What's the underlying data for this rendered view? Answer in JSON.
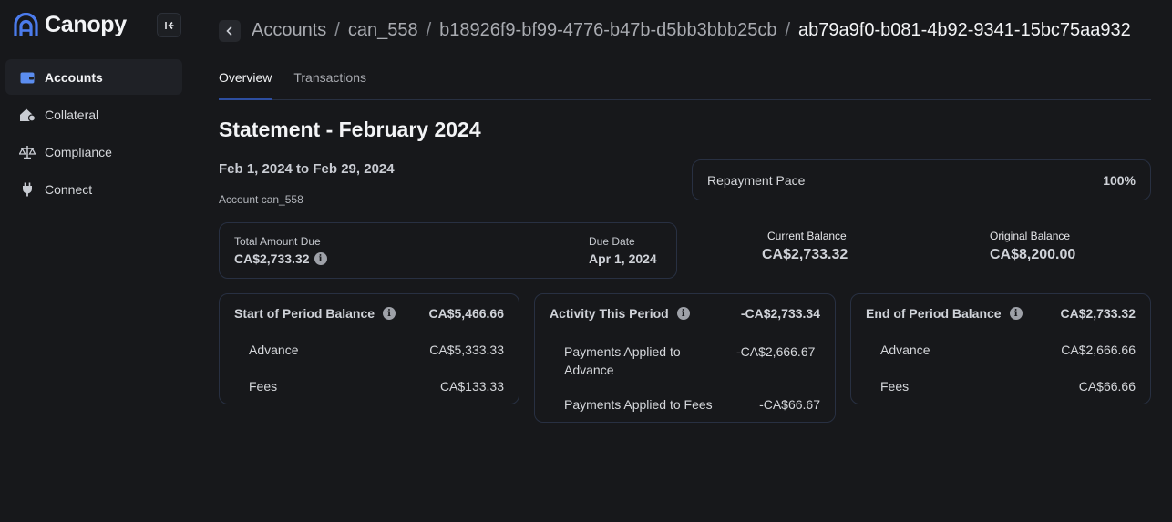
{
  "brand": {
    "name": "Canopy"
  },
  "sidebar": {
    "items": [
      {
        "label": "Accounts",
        "icon": "wallet-icon",
        "active": true
      },
      {
        "label": "Collateral",
        "icon": "house-icon",
        "active": false
      },
      {
        "label": "Compliance",
        "icon": "scale-icon",
        "active": false
      },
      {
        "label": "Connect",
        "icon": "plug-icon",
        "active": false
      }
    ]
  },
  "breadcrumb": {
    "items": [
      "Accounts",
      "can_558",
      "b18926f9-bf99-4776-b47b-d5bb3bbb25cb",
      "ab79a9f0-b081-4b92-9341-15bc75aa932"
    ],
    "separator": "/"
  },
  "tabs": [
    {
      "label": "Overview",
      "active": true
    },
    {
      "label": "Transactions",
      "active": false
    }
  ],
  "statement": {
    "title": "Statement - February 2024",
    "period": "Feb 1, 2024 to Feb 29, 2024",
    "account": "Account can_558",
    "repayment_pace_label": "Repayment Pace",
    "repayment_pace_value": "100%",
    "total_due_label": "Total Amount Due",
    "total_due_value": "CA$2,733.32",
    "due_date_label": "Due Date",
    "due_date_value": "Apr 1, 2024",
    "current_balance_label": "Current Balance",
    "current_balance_value": "CA$2,733.32",
    "original_balance_label": "Original Balance",
    "original_balance_value": "CA$8,200.00"
  },
  "cards": {
    "start": {
      "title": "Start of Period Balance",
      "total": "CA$5,466.66",
      "rows": [
        {
          "label": "Advance",
          "value": "CA$5,333.33"
        },
        {
          "label": "Fees",
          "value": "CA$133.33"
        }
      ]
    },
    "activity": {
      "title": "Activity This Period",
      "total": "-CA$2,733.34",
      "rows": [
        {
          "label": "Payments Applied to Advance",
          "value": "-CA$2,666.67"
        },
        {
          "label": "Payments Applied to Fees",
          "value": "-CA$66.67"
        }
      ]
    },
    "end": {
      "title": "End of Period Balance",
      "total": "CA$2,733.32",
      "rows": [
        {
          "label": "Advance",
          "value": "CA$2,666.66"
        },
        {
          "label": "Fees",
          "value": "CA$66.66"
        }
      ]
    }
  },
  "colors": {
    "accent": "#4b7bec",
    "background": "#17181b",
    "border": "#283042"
  }
}
